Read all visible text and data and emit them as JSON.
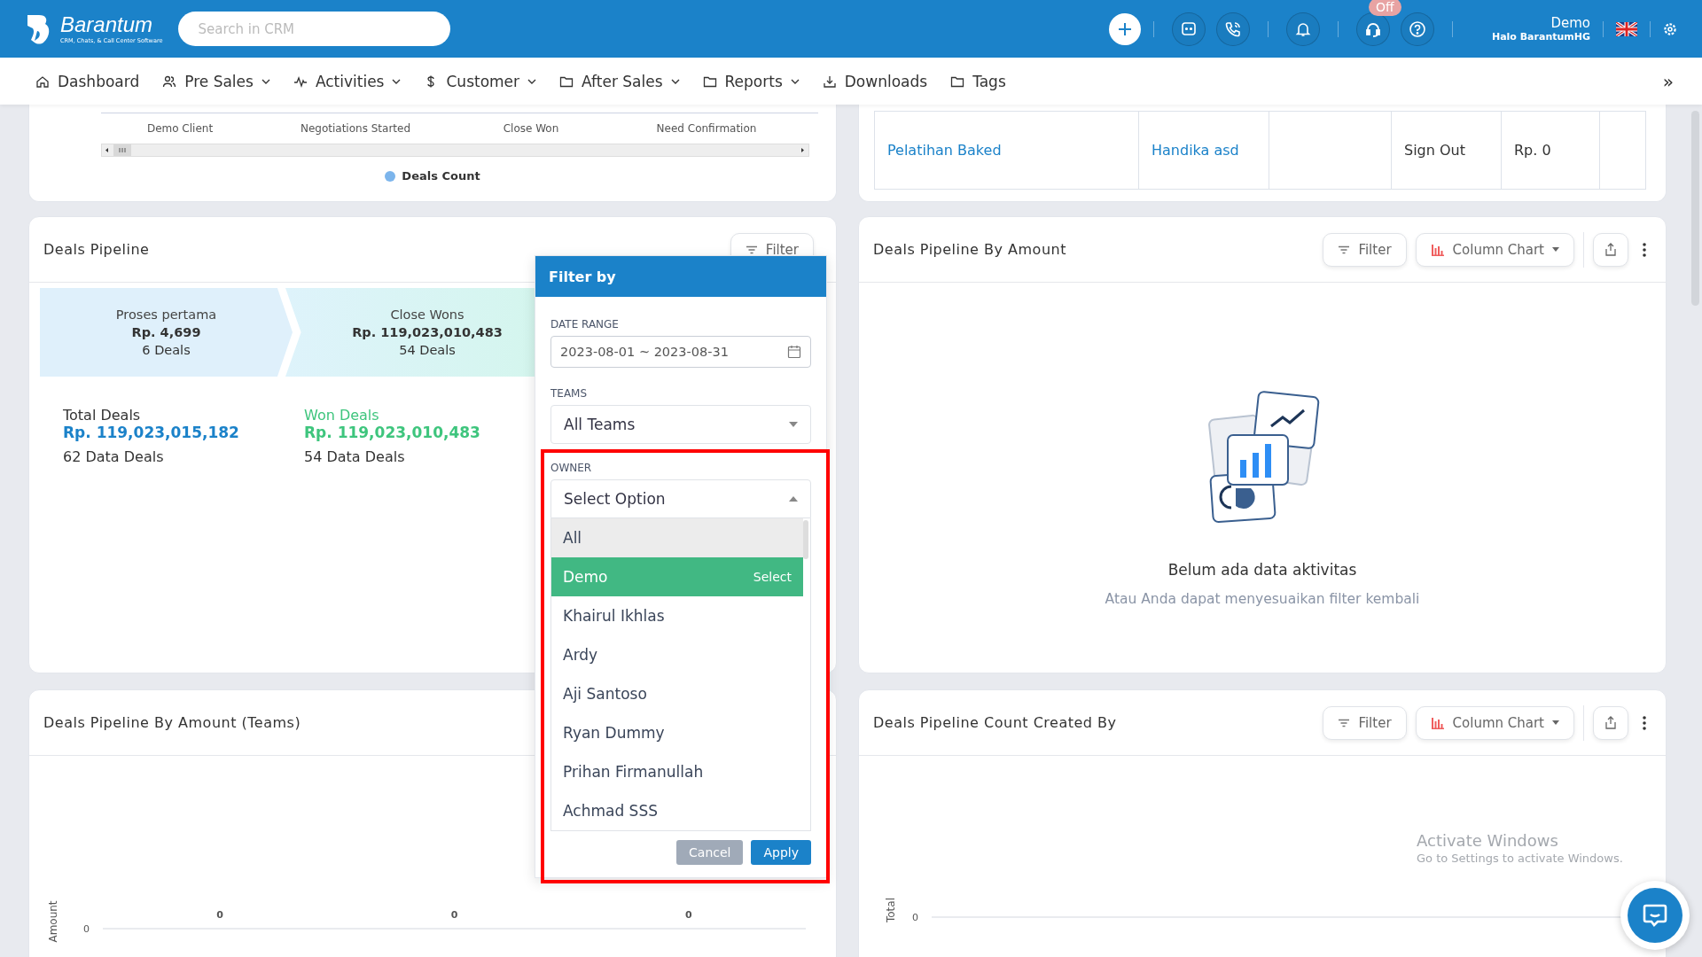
{
  "header": {
    "brand": "Barantum",
    "tagline": "CRM, Chats, & Call Center Software",
    "search": {
      "placeholder": "Search in CRM"
    },
    "status_badge": "Off",
    "user": {
      "name": "Demo",
      "subtitle": "Halo BarantumHG"
    }
  },
  "nav": {
    "items": [
      {
        "label": "Dashboard",
        "kind": "link"
      },
      {
        "label": "Pre Sales",
        "kind": "menu"
      },
      {
        "label": "Activities",
        "kind": "menu"
      },
      {
        "label": "Customer",
        "kind": "menu"
      },
      {
        "label": "After Sales",
        "kind": "menu"
      },
      {
        "label": "Reports",
        "kind": "menu"
      },
      {
        "label": "Downloads",
        "kind": "link"
      },
      {
        "label": "Tags",
        "kind": "link"
      }
    ],
    "more": "»"
  },
  "deals_count_card": {
    "axis_labels": [
      "Demo Client",
      "Negotiations Started",
      "Close Won",
      "Need Confirmation"
    ],
    "legend": [
      {
        "label": "Deals Count",
        "color": "#7cb5ec"
      }
    ]
  },
  "activity_table": {
    "rows": [
      {
        "cells": [
          {
            "kind": "link",
            "text": "Pelatihan Baked"
          },
          {
            "kind": "link",
            "text": "Handika asd"
          },
          {
            "kind": "empty"
          },
          {
            "kind": "text",
            "text": "Sign Out"
          },
          {
            "kind": "text",
            "text": "Rp. 0"
          },
          {
            "kind": "empty"
          }
        ]
      }
    ]
  },
  "deals_pipeline": {
    "title": "Deals Pipeline",
    "filter_button": "Filter",
    "stages": [
      {
        "name": "Proses pertama",
        "amount": "Rp. 4,699",
        "deals": "6 Deals"
      },
      {
        "name": "Close Wons",
        "amount": "Rp. 119,023,010,483",
        "deals": "54 Deals"
      }
    ],
    "totals": [
      {
        "kind": "total",
        "label": "Total Deals",
        "amount": "Rp. 119,023,015,182",
        "count": "62 Data Deals"
      },
      {
        "kind": "won",
        "label": "Won Deals",
        "amount": "Rp. 119,023,010,483",
        "count": "54 Data Deals"
      }
    ]
  },
  "filter_popup": {
    "title": "Filter by",
    "date_range": {
      "label": "DATE RANGE",
      "value": "2023-08-01 ~ 2023-08-31"
    },
    "teams": {
      "label": "TEAMS",
      "value": "All Teams"
    },
    "owner": {
      "label": "OWNER",
      "placeholder": "Select Option",
      "expanded": true,
      "highlight_hint": "Select",
      "options": [
        {
          "label": "All",
          "selected": true,
          "highlighted": false
        },
        {
          "label": "Demo",
          "selected": false,
          "highlighted": true
        },
        {
          "label": "Khairul Ikhlas",
          "selected": false,
          "highlighted": false
        },
        {
          "label": "Ardy",
          "selected": false,
          "highlighted": false
        },
        {
          "label": "Aji Santoso",
          "selected": false,
          "highlighted": false
        },
        {
          "label": "Ryan Dummy",
          "selected": false,
          "highlighted": false
        },
        {
          "label": "Prihan Firmanullah",
          "selected": false,
          "highlighted": false
        },
        {
          "label": "Achmad SSS",
          "selected": false,
          "highlighted": false
        }
      ]
    },
    "buttons": [
      {
        "kind": "secondary",
        "label": "Cancel"
      },
      {
        "kind": "primary",
        "label": "Apply"
      }
    ]
  },
  "amount_card": {
    "title": "Deals Pipeline By Amount",
    "filter_button": "Filter",
    "chart_type": "Column Chart",
    "empty_state": {
      "title": "Belum ada data aktivitas",
      "message": "Atau Anda dapat menyesuaikan filter kembali"
    }
  },
  "teams_card": {
    "title": "Deals Pipeline By Amount (Teams)",
    "axis_title": "Amount",
    "axis_tick": "0",
    "value_labels": [
      "0",
      "0",
      "0"
    ]
  },
  "created_by_card": {
    "title": "Deals Pipeline Count Created By",
    "filter_button": "Filter",
    "chart_type": "Column Chart",
    "axis_title": "Total",
    "axis_tick": "0"
  },
  "os_notice": {
    "title": "Activate Windows",
    "message": "Go to Settings to activate Windows."
  }
}
